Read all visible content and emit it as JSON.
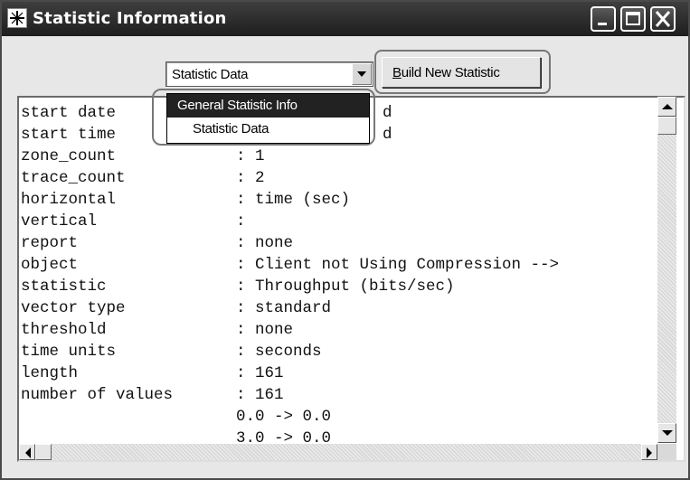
{
  "window": {
    "title": "Statistic Information",
    "icons": [
      "app-icon",
      "minimize-icon",
      "maximize-icon",
      "close-icon"
    ]
  },
  "toolbar": {
    "select_value": "Statistic Data",
    "build_label_pre": "",
    "build_label_mnemonic": "B",
    "build_label_rest": "uild New Statistic"
  },
  "dropdown": {
    "options": [
      "General Statistic Info",
      "Statistic Data"
    ],
    "highlighted": "General Statistic Info"
  },
  "content": {
    "rows": [
      {
        "key": "start date",
        "value": "d"
      },
      {
        "key": "start time",
        "value": "d"
      },
      {
        "key": "zone_count",
        "value": ": 1"
      },
      {
        "key": "trace_count",
        "value": ": 2"
      },
      {
        "key": "horizontal",
        "value": ": time (sec)"
      },
      {
        "key": "vertical",
        "value": ":"
      },
      {
        "key": "report",
        "value": ": none"
      },
      {
        "key": "object",
        "value": ": Client not Using Compression -->"
      },
      {
        "key": "statistic",
        "value": ": Throughput (bits/sec)"
      },
      {
        "key": "vector type",
        "value": ": standard"
      },
      {
        "key": "threshold",
        "value": ": none"
      },
      {
        "key": "time units",
        "value": ": seconds"
      },
      {
        "key": "length",
        "value": ": 161"
      },
      {
        "key": "number of values",
        "value": ": 161"
      },
      {
        "key": "",
        "value": "0.0 -> 0.0"
      },
      {
        "key": "",
        "value": "3.0 -> 0.0"
      }
    ]
  },
  "colors": {
    "titlebar": "#2a2a2a",
    "dropdown_selected": "#222222",
    "highlight_outline": "#777777"
  }
}
